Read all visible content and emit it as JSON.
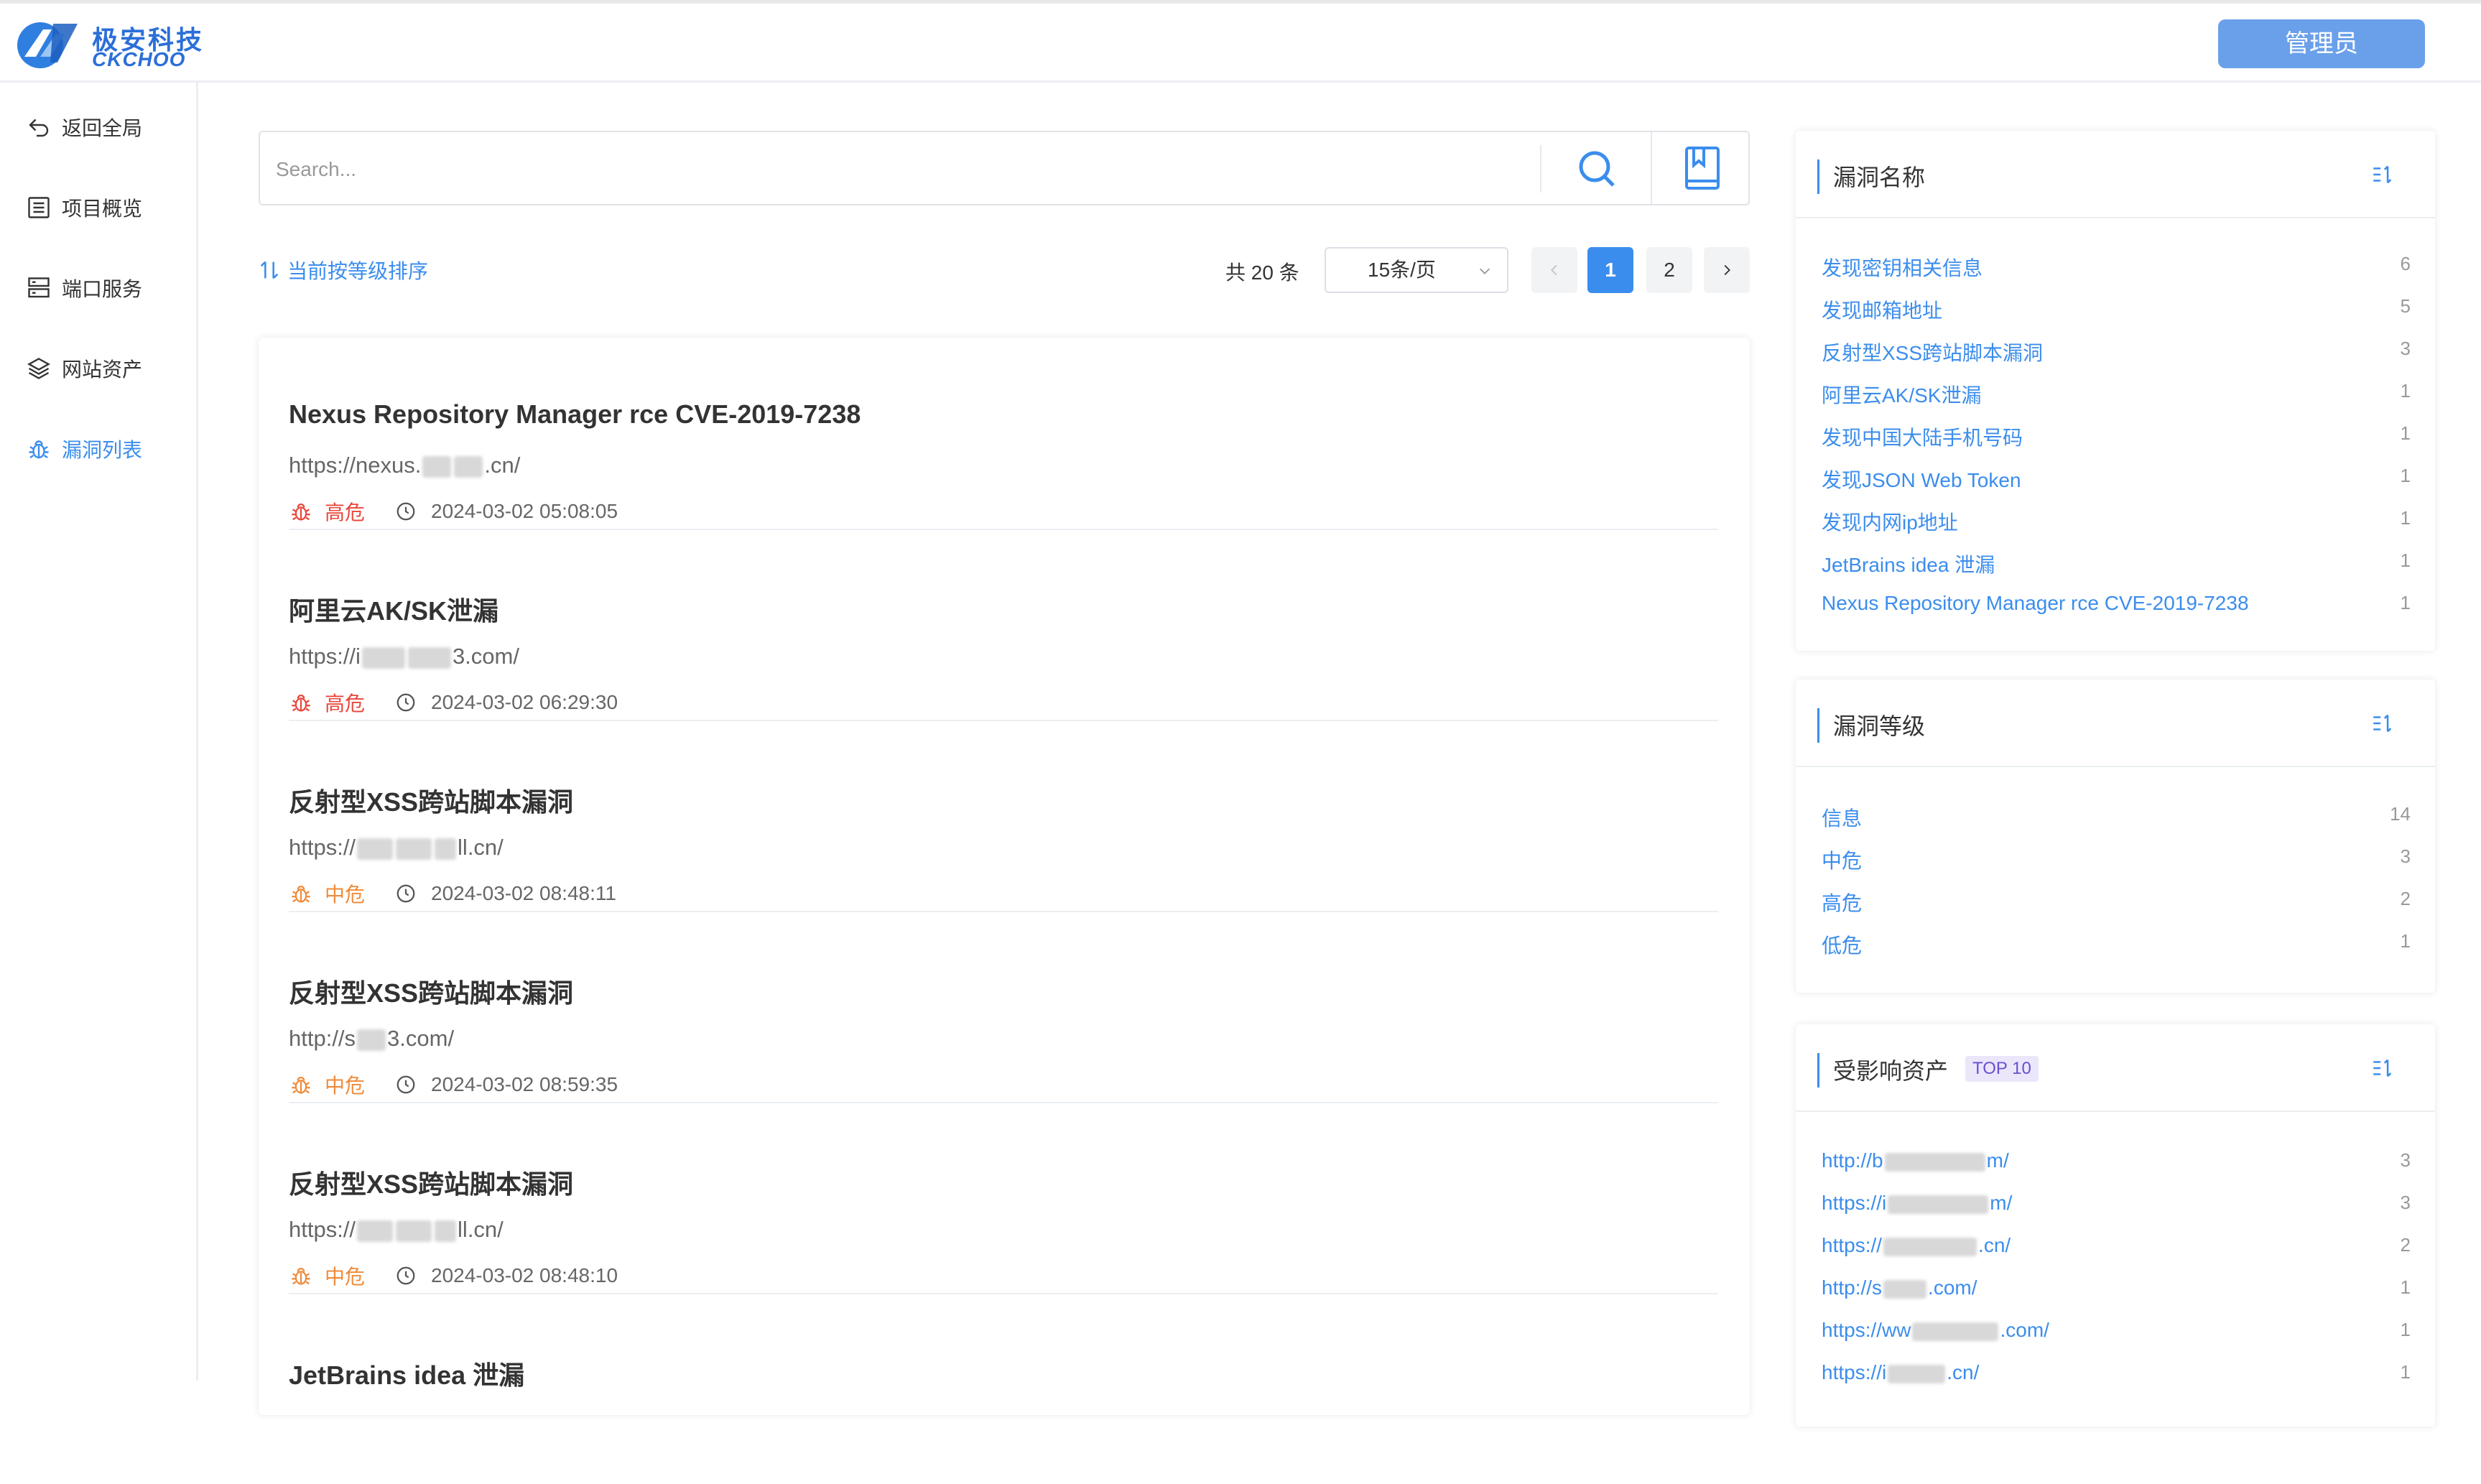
{
  "brand": {
    "name_cn": "极安科技",
    "name_en": "CKCHOO"
  },
  "header": {
    "admin_label": "管理员"
  },
  "sidebar": {
    "items": [
      {
        "label": "返回全局",
        "icon": "back-icon",
        "active": false
      },
      {
        "label": "项目概览",
        "icon": "list-icon",
        "active": false
      },
      {
        "label": "端口服务",
        "icon": "server-icon",
        "active": false
      },
      {
        "label": "网站资产",
        "icon": "layers-icon",
        "active": false
      },
      {
        "label": "漏洞列表",
        "icon": "bug-icon",
        "active": true
      }
    ]
  },
  "search": {
    "placeholder": "Search...",
    "value": ""
  },
  "toolbar": {
    "sort_label": "当前按等级排序",
    "total_label": "共 20 条",
    "page_size": "15条/页",
    "pages": [
      "1",
      "2"
    ],
    "current_page": "1"
  },
  "vulns": [
    {
      "title": "Nexus Repository Manager rce CVE-2019-7238",
      "url_prefix": "https://nexus.",
      "url_suffix": ".cn/",
      "level": "高危",
      "time": "2024-03-02 05:08:05"
    },
    {
      "title": "阿里云AK/SK泄漏",
      "url_prefix": "https://i",
      "url_suffix": "3.com/",
      "level": "高危",
      "time": "2024-03-02 06:29:30"
    },
    {
      "title": "反射型XSS跨站脚本漏洞",
      "url_prefix": "https://",
      "url_suffix": "ll.cn/",
      "level": "中危",
      "time": "2024-03-02 08:48:11"
    },
    {
      "title": "反射型XSS跨站脚本漏洞",
      "url_prefix": "http://s",
      "url_suffix": "3.com/",
      "level": "中危",
      "time": "2024-03-02 08:59:35"
    },
    {
      "title": "反射型XSS跨站脚本漏洞",
      "url_prefix": "https://",
      "url_suffix": "ll.cn/",
      "level": "中危",
      "time": "2024-03-02 08:48:10"
    },
    {
      "title": "JetBrains idea 泄漏",
      "url_prefix": "",
      "url_suffix": "",
      "level": "",
      "time": ""
    }
  ],
  "colors": {
    "accent": "#3b8ded",
    "high": "#e8473c",
    "medium": "#ef8b3a"
  },
  "panels": {
    "names": {
      "title": "漏洞名称",
      "rows": [
        {
          "label": "发现密钥相关信息",
          "count": "6"
        },
        {
          "label": "发现邮箱地址",
          "count": "5"
        },
        {
          "label": "反射型XSS跨站脚本漏洞",
          "count": "3"
        },
        {
          "label": "阿里云AK/SK泄漏",
          "count": "1"
        },
        {
          "label": "发现中国大陆手机号码",
          "count": "1"
        },
        {
          "label": "发现JSON Web Token",
          "count": "1"
        },
        {
          "label": "发现内网ip地址",
          "count": "1"
        },
        {
          "label": "JetBrains idea 泄漏",
          "count": "1"
        },
        {
          "label": "Nexus Repository Manager rce CVE-2019-7238",
          "count": "1"
        }
      ]
    },
    "levels": {
      "title": "漏洞等级",
      "rows": [
        {
          "label": "信息",
          "count": "14"
        },
        {
          "label": "中危",
          "count": "3"
        },
        {
          "label": "高危",
          "count": "2"
        },
        {
          "label": "低危",
          "count": "1"
        }
      ]
    },
    "assets": {
      "title": "受影响资产",
      "badge": "TOP 10",
      "rows": [
        {
          "label_prefix": "http://b",
          "label_suffix": "m/",
          "count": "3"
        },
        {
          "label_prefix": "https://i",
          "label_suffix": "m/",
          "count": "3"
        },
        {
          "label_prefix": "https://",
          "label_suffix": ".cn/",
          "count": "2"
        },
        {
          "label_prefix": "http://s",
          "label_suffix": ".com/",
          "count": "1"
        },
        {
          "label_prefix": "https://ww",
          "label_suffix": ".com/",
          "count": "1"
        },
        {
          "label_prefix": "https://i",
          "label_suffix": ".cn/",
          "count": "1"
        }
      ]
    }
  }
}
